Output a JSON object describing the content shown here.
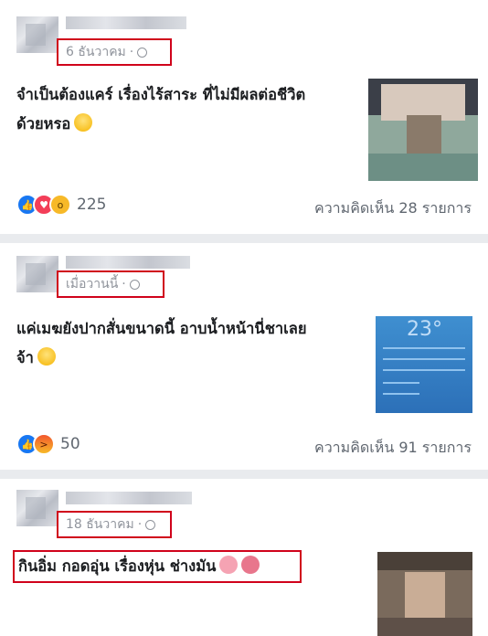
{
  "posts": [
    {
      "date": "6 ธันวาคม",
      "text_line1": "จำเป็นต้องแคร์ เรื่องไร้สาระ ที่ไม่มีผลต่อชีวิต",
      "text_line2": "ด้วยหรอ",
      "reaction_count": "225",
      "comments": "ความคิดเห็น 28 รายการ"
    },
    {
      "date": "เมื่อวานนี้",
      "text_line1": "แค่เมฆยังปากสั่นขนาดนี้ อาบน้ำหน้านี่ชาเลย",
      "text_line2": "จ้า",
      "reaction_count": "50",
      "comments": "ความคิดเห็น 91 รายการ",
      "thumb_temp": "23°"
    },
    {
      "date": "18 ธันวาคม",
      "text_line1": "กินอิ่ม กอดอุ่น เรื่องหุ่น ช่างมัน"
    }
  ],
  "icons": {
    "globe": "globe-icon",
    "like": "like-reaction-icon",
    "love": "love-reaction-icon",
    "wow": "wow-reaction-icon",
    "angry": "angry-reaction-icon"
  },
  "colors": {
    "highlight": "#d0021b",
    "like": "#1877f2",
    "love": "#f33e58",
    "meta_text": "#90949c"
  }
}
